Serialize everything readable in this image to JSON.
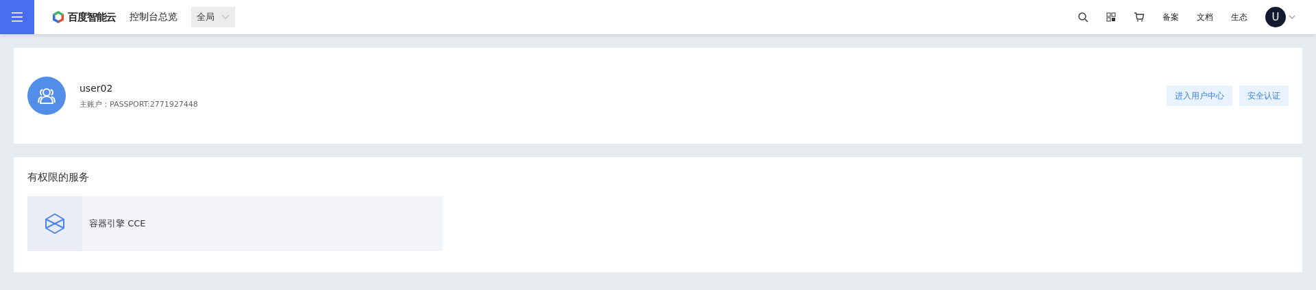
{
  "header": {
    "brand": "百度智能云",
    "title": "控制台总览",
    "region": "全局",
    "links": [
      "备案",
      "文档",
      "生态"
    ],
    "avatar": "U"
  },
  "user": {
    "name": "user02",
    "account": "主账户：PASSPORT:2771927448",
    "buttons": [
      "进入用户中心",
      "安全认证"
    ]
  },
  "services": {
    "title": "有权限的服务",
    "items": [
      {
        "name": "容器引擎 CCE"
      }
    ]
  }
}
